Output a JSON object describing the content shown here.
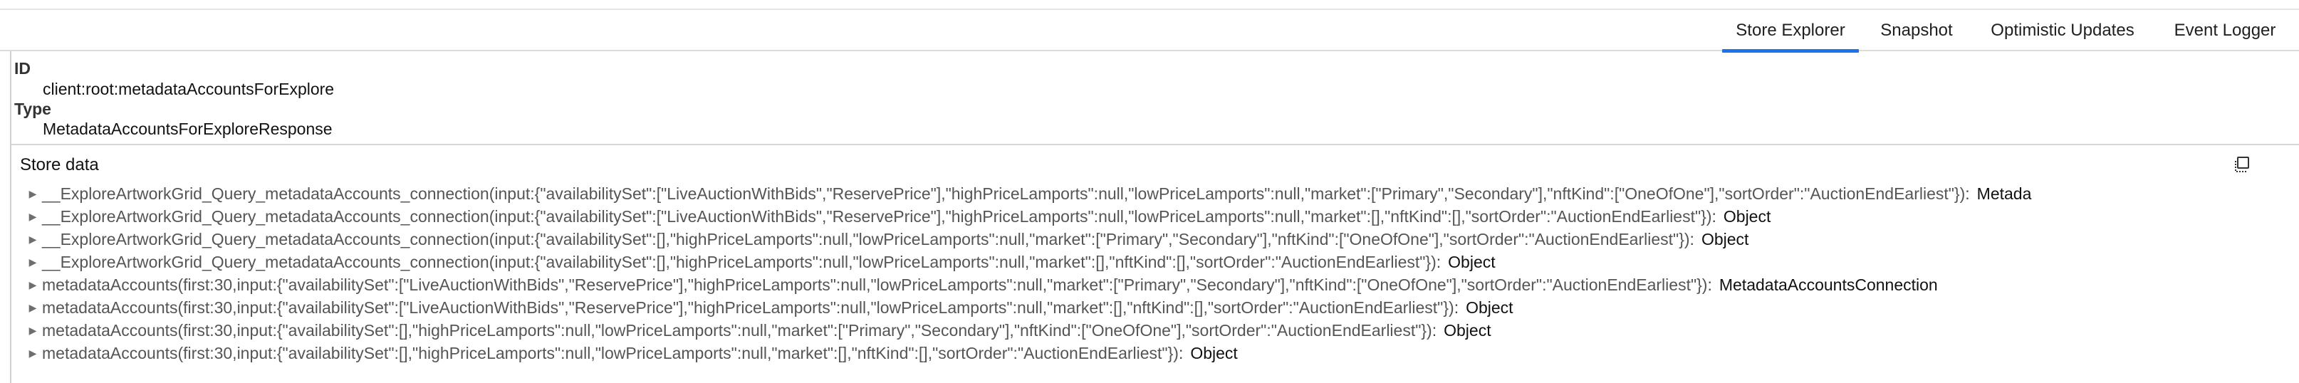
{
  "tabs": [
    {
      "label": "Store Explorer",
      "active": true
    },
    {
      "label": "Snapshot",
      "active": false
    },
    {
      "label": "Optimistic Updates",
      "active": false
    },
    {
      "label": "Event Logger",
      "active": false
    }
  ],
  "record": {
    "id_label": "ID",
    "id_value": "client:root:metadataAccountsForExplore",
    "type_label": "Type",
    "type_value": "MetadataAccountsForExploreResponse"
  },
  "store": {
    "title": "Store data",
    "rows": [
      {
        "key": "__ExploreArtworkGrid_Query_metadataAccounts_connection(input:{\"availabilitySet\":[\"LiveAuctionWithBids\",\"ReservePrice\"],\"highPriceLamports\":null,\"lowPriceLamports\":null,\"market\":[\"Primary\",\"Secondary\"],\"nftKind\":[\"OneOfOne\"],\"sortOrder\":\"AuctionEndEarliest\"})",
        "sep": ":",
        "type": "Metada"
      },
      {
        "key": "__ExploreArtworkGrid_Query_metadataAccounts_connection(input:{\"availabilitySet\":[\"LiveAuctionWithBids\",\"ReservePrice\"],\"highPriceLamports\":null,\"lowPriceLamports\":null,\"market\":[],\"nftKind\":[],\"sortOrder\":\"AuctionEndEarliest\"})",
        "sep": ":",
        "type": "Object"
      },
      {
        "key": "__ExploreArtworkGrid_Query_metadataAccounts_connection(input:{\"availabilitySet\":[],\"highPriceLamports\":null,\"lowPriceLamports\":null,\"market\":[\"Primary\",\"Secondary\"],\"nftKind\":[\"OneOfOne\"],\"sortOrder\":\"AuctionEndEarliest\"})",
        "sep": ":",
        "type": "Object"
      },
      {
        "key": "__ExploreArtworkGrid_Query_metadataAccounts_connection(input:{\"availabilitySet\":[],\"highPriceLamports\":null,\"lowPriceLamports\":null,\"market\":[],\"nftKind\":[],\"sortOrder\":\"AuctionEndEarliest\"})",
        "sep": ":",
        "type": "Object"
      },
      {
        "key": "metadataAccounts(first:30,input:{\"availabilitySet\":[\"LiveAuctionWithBids\",\"ReservePrice\"],\"highPriceLamports\":null,\"lowPriceLamports\":null,\"market\":[\"Primary\",\"Secondary\"],\"nftKind\":[\"OneOfOne\"],\"sortOrder\":\"AuctionEndEarliest\"})",
        "sep": ":",
        "type": "MetadataAccountsConnection"
      },
      {
        "key": "metadataAccounts(first:30,input:{\"availabilitySet\":[\"LiveAuctionWithBids\",\"ReservePrice\"],\"highPriceLamports\":null,\"lowPriceLamports\":null,\"market\":[],\"nftKind\":[],\"sortOrder\":\"AuctionEndEarliest\"})",
        "sep": ":",
        "type": "Object"
      },
      {
        "key": "metadataAccounts(first:30,input:{\"availabilitySet\":[],\"highPriceLamports\":null,\"lowPriceLamports\":null,\"market\":[\"Primary\",\"Secondary\"],\"nftKind\":[\"OneOfOne\"],\"sortOrder\":\"AuctionEndEarliest\"})",
        "sep": ":",
        "type": "Object"
      },
      {
        "key": "metadataAccounts(first:30,input:{\"availabilitySet\":[],\"highPriceLamports\":null,\"lowPriceLamports\":null,\"market\":[],\"nftKind\":[],\"sortOrder\":\"AuctionEndEarliest\"})",
        "sep": ":",
        "type": "Object"
      }
    ]
  },
  "icons": {
    "copy": "copy-icon",
    "expand": "chevron-right-icon"
  },
  "colors": {
    "accent": "#1a73e8"
  }
}
